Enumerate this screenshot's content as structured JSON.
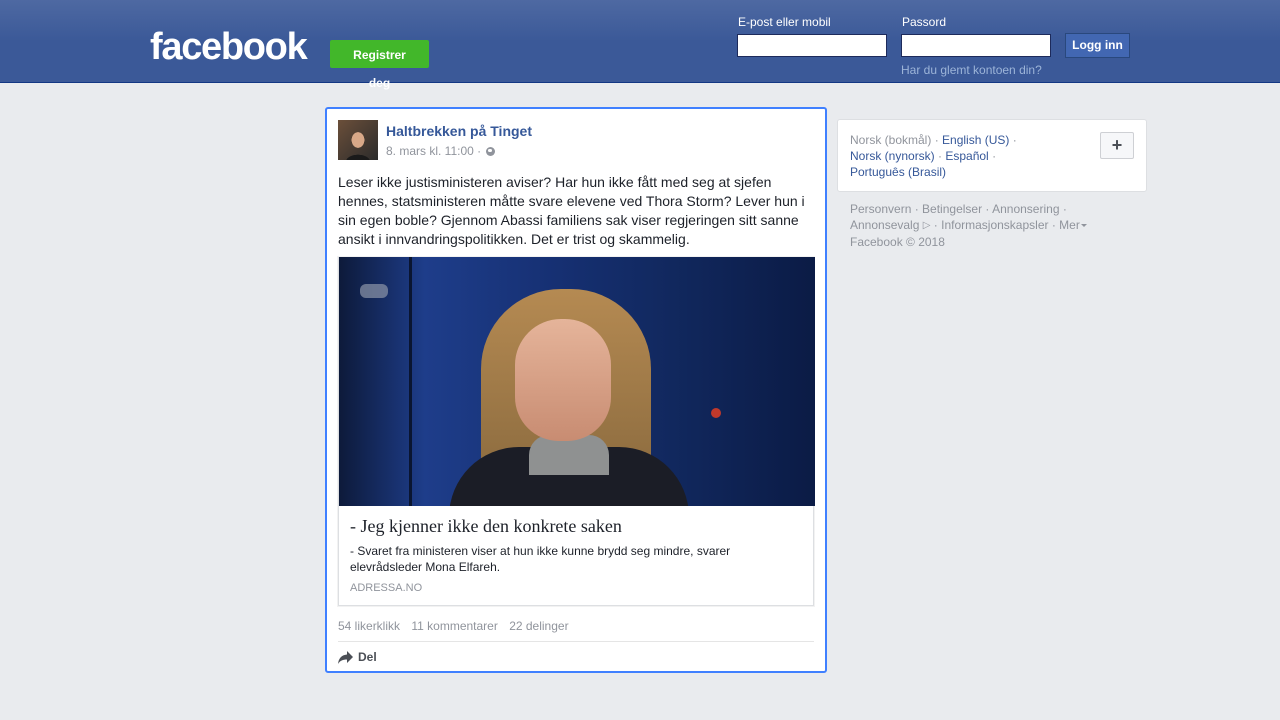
{
  "header": {
    "logo": "facebook",
    "register_label": "Registrer deg",
    "email_label": "E-post eller mobil",
    "password_label": "Passord",
    "email_value": "",
    "password_value": "",
    "login_label": "Logg inn",
    "forgot_label": "Har du glemt kontoen din?"
  },
  "post": {
    "author": "Haltbrekken på Tinget",
    "timestamp": "8. mars kl. 11:00 ·",
    "privacy_icon": "globe-icon",
    "text": "Leser ikke justisministeren aviser? Har hun ikke fått med seg at sjefen hennes, statsministeren måtte svare elevene ved Thora Storm? Lever hun i sin egen boble? Gjennom Abassi familiens sak viser regjeringen sitt sanne ansikt i innvandringspolitikken. Det er trist og skammelig.",
    "link": {
      "title": "- Jeg kjenner ikke den konkrete saken",
      "description": "- Svaret fra ministeren viser at hun ikke kunne brydd seg mindre, svarer elevrådsleder Mona Elfareh.",
      "domain": "ADRESSA.NO"
    },
    "stats": {
      "likes": "54 likerklikk",
      "comments": "11 kommentarer",
      "shares": "22 delinger"
    },
    "share_label": "Del"
  },
  "languages": {
    "current": "Norsk (bokmål)",
    "items": [
      "English (US)",
      "Norsk (nynorsk)",
      "Español",
      "Português (Brasil)"
    ],
    "add_label": "+"
  },
  "footer": {
    "links": [
      "Personvern",
      "Betingelser",
      "Annonsering",
      "Annonsevalg",
      "Informasjonskapsler",
      "Mer"
    ],
    "copyright": "Facebook © 2018"
  },
  "colors": {
    "brand_blue": "#3b5998",
    "register_green": "#42b72a",
    "link_blue": "#365899",
    "focus_border": "#4080ff"
  }
}
